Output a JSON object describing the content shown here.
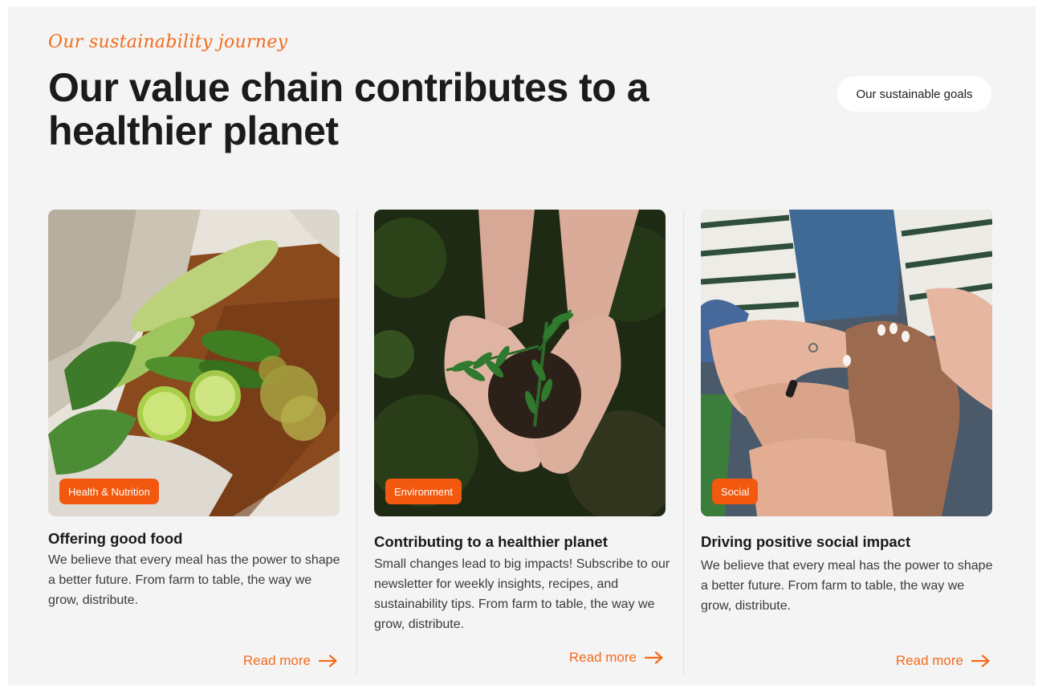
{
  "header": {
    "eyebrow": "Our sustainability journey",
    "title": "Our value chain contributes to a healthier planet",
    "goals_button": "Our sustainable goals"
  },
  "cards": [
    {
      "badge": "Health & Nutrition",
      "title": "Offering good food",
      "description": "We believe that every meal has the power to shape a better future. From farm to table, the way we grow, distribute.",
      "link": "Read more",
      "image": "vegetables-on-cutting-board"
    },
    {
      "badge": "Environment",
      "title": "Contributing to a healthier planet",
      "description": "Small changes lead to big impacts! Subscribe to our newsletter for weekly insights, recipes, and sustainability tips. From farm to table, the way we grow, distribute.",
      "link": "Read more",
      "image": "hands-holding-seedling"
    },
    {
      "badge": "Social",
      "title": "Driving positive social impact",
      "description": "We believe that every meal has the power to shape a better future. From farm to table, the way we grow, distribute.",
      "link": "Read more",
      "image": "stacked-hands-teamwork"
    }
  ],
  "colors": {
    "accent": "#f26b1d",
    "badge": "#f2590f",
    "background": "#f4f4f4",
    "heading": "#1b1b1b"
  },
  "icons": {
    "link_arrow": "arrow-right-icon"
  }
}
